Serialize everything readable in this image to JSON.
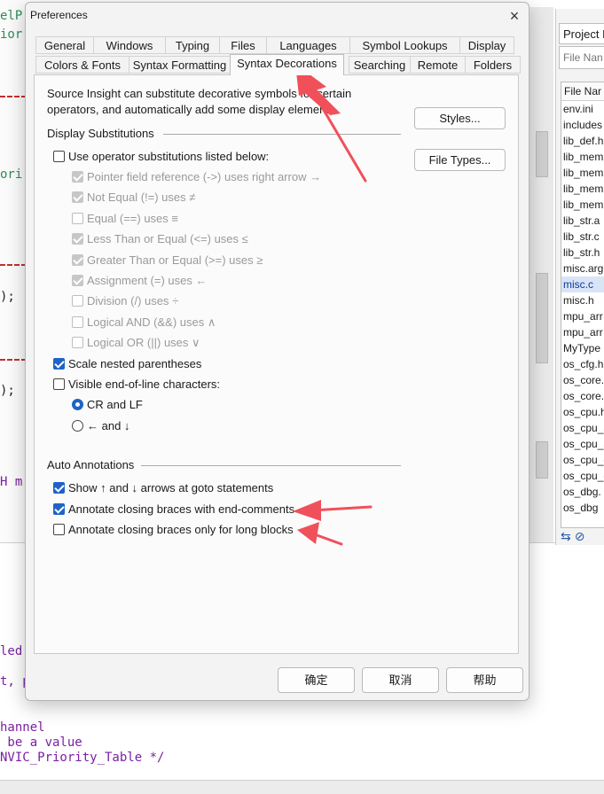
{
  "editor": {
    "code_lines": [
      "elP",
      "ior",
      "ori",
      ");",
      ");",
      "H m",
      "led",
      "t, p",
      "hannel",
      " be a value",
      "NVIC_Priority_Table */"
    ]
  },
  "project": {
    "title": "Project F",
    "search_placeholder": "File Nan",
    "column_header": "File Nar",
    "files": [
      "env.ini",
      "includes",
      "lib_def.h",
      "lib_mem",
      "lib_mem",
      "lib_mem",
      "lib_mem",
      "lib_str.a",
      "lib_str.c",
      "lib_str.h",
      "misc.arg",
      "misc.c",
      "misc.h",
      "mpu_arr",
      "mpu_arr",
      "MyType",
      "os_cfg.h",
      "os_core.",
      "os_core.",
      "os_cpu.h",
      "os_cpu_a",
      "os_cpu_a",
      "os_cpu_c",
      "os_cpu_c",
      "os_dbg.",
      "os_dbg"
    ],
    "selected_file": "misc.c"
  },
  "dialog": {
    "title": "Preferences",
    "close_glyph": "×",
    "tabs_row1": [
      "General",
      "Windows",
      "Typing",
      "Files",
      "Languages",
      "Symbol Lookups",
      "Display"
    ],
    "tabs_row2": [
      "Colors & Fonts",
      "Syntax Formatting",
      "Syntax Decorations",
      "Searching",
      "Remote",
      "Folders"
    ],
    "active_tab": "Syntax Decorations",
    "intro": "Source Insight can substitute decorative symbols for certain operators, and automatically add some display elements.",
    "styles_button": "Styles...",
    "file_types_button": "File Types...",
    "display_substitutions": {
      "heading": "Display Substitutions",
      "use_operator": {
        "label": "Use operator substitutions listed below:",
        "checked": false
      },
      "items": [
        {
          "label": "Pointer field reference (->) uses right arrow →",
          "checked": true
        },
        {
          "label": "Not Equal (!=) uses ≠",
          "checked": true
        },
        {
          "label": "Equal (==) uses ≡",
          "checked": false
        },
        {
          "label": "Less Than or Equal (<=) uses ≤",
          "checked": true
        },
        {
          "label": "Greater Than or Equal (>=) uses ≥",
          "checked": true
        },
        {
          "label": "Assignment (=) uses ←",
          "checked": true
        },
        {
          "label": "Division (/) uses ÷",
          "checked": false
        },
        {
          "label": "Logical AND (&&) uses ∧",
          "checked": false
        },
        {
          "label": "Logical OR (||) uses ∨",
          "checked": false
        }
      ],
      "scale_nested": {
        "label": "Scale nested parentheses",
        "checked": true
      },
      "visible_eol": {
        "label": "Visible end-of-line characters:",
        "checked": false
      },
      "eol_options": [
        {
          "label": "CR and LF",
          "selected": true
        },
        {
          "label": "← and ↓",
          "selected": false
        }
      ]
    },
    "auto_annotations": {
      "heading": "Auto Annotations",
      "items": [
        {
          "label": "Show ↑ and ↓ arrows at goto statements",
          "checked": true
        },
        {
          "label": "Annotate closing braces with end-comments",
          "checked": true
        },
        {
          "label": "Annotate closing braces only for long blocks",
          "checked": false
        }
      ]
    },
    "footer": {
      "ok": "确定",
      "cancel": "取消",
      "help": "帮助"
    }
  },
  "colors": {
    "accent": "#1f63c6",
    "annotation_arrow": "#f0505a"
  }
}
